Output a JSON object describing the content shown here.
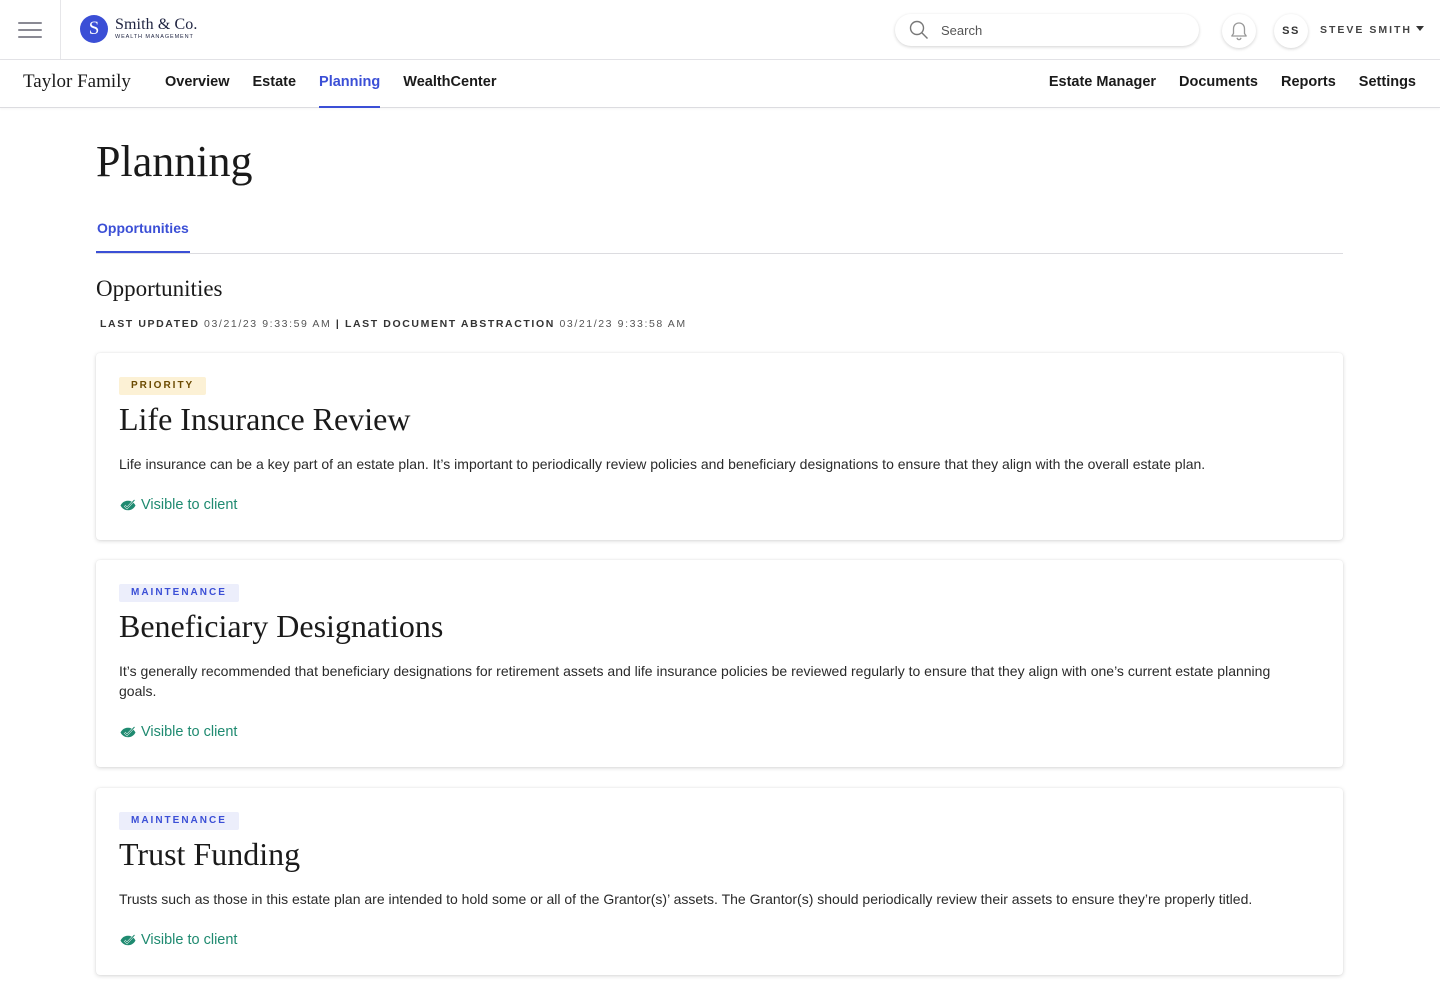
{
  "brand": {
    "initial": "S",
    "name": "Smith & Co.",
    "subtitle": "WEALTH MANAGEMENT"
  },
  "search": {
    "placeholder": "Search"
  },
  "user": {
    "initials": "SS",
    "name": "STEVE SMITH"
  },
  "family": "Taylor Family",
  "nav_left": [
    {
      "label": "Overview",
      "active": false
    },
    {
      "label": "Estate",
      "active": false
    },
    {
      "label": "Planning",
      "active": true
    },
    {
      "label": "WealthCenter",
      "active": false
    }
  ],
  "nav_right": [
    {
      "label": "Estate Manager"
    },
    {
      "label": "Documents"
    },
    {
      "label": "Reports"
    },
    {
      "label": "Settings"
    }
  ],
  "page_title": "Planning",
  "tab": "Opportunities",
  "section_title": "Opportunities",
  "meta": {
    "updated_label": "LAST UPDATED",
    "updated_value": "03/21/23 9:33:59 AM",
    "separator": "|",
    "abstraction_label": "LAST DOCUMENT ABSTRACTION",
    "abstraction_value": "03/21/23 9:33:58 AM"
  },
  "colors": {
    "accent": "#3b4fd6",
    "visible": "#1f8a70",
    "priority_bg": "#fcf1d5",
    "maintenance_bg": "#eceefb"
  },
  "cards": [
    {
      "badge": "PRIORITY",
      "badge_type": "priority",
      "title": "Life Insurance Review",
      "description": "Life insurance can be a key part of an estate plan. It’s important to periodically review policies and beneficiary designations to ensure that they align with the overall estate plan.",
      "visibility": "Visible to client"
    },
    {
      "badge": "MAINTENANCE",
      "badge_type": "maintenance",
      "title": "Beneficiary Designations",
      "description": "It’s generally recommended that beneficiary designations for retirement assets and life insurance policies be reviewed regularly to ensure that they align with one’s current estate planning goals.",
      "visibility": "Visible to client"
    },
    {
      "badge": "MAINTENANCE",
      "badge_type": "maintenance",
      "title": "Trust Funding",
      "description": "Trusts such as those in this estate plan are intended to hold some or all of the Grantor(s)’ assets. The Grantor(s) should periodically review their assets to ensure they’re properly titled.",
      "visibility": "Visible to client"
    }
  ]
}
